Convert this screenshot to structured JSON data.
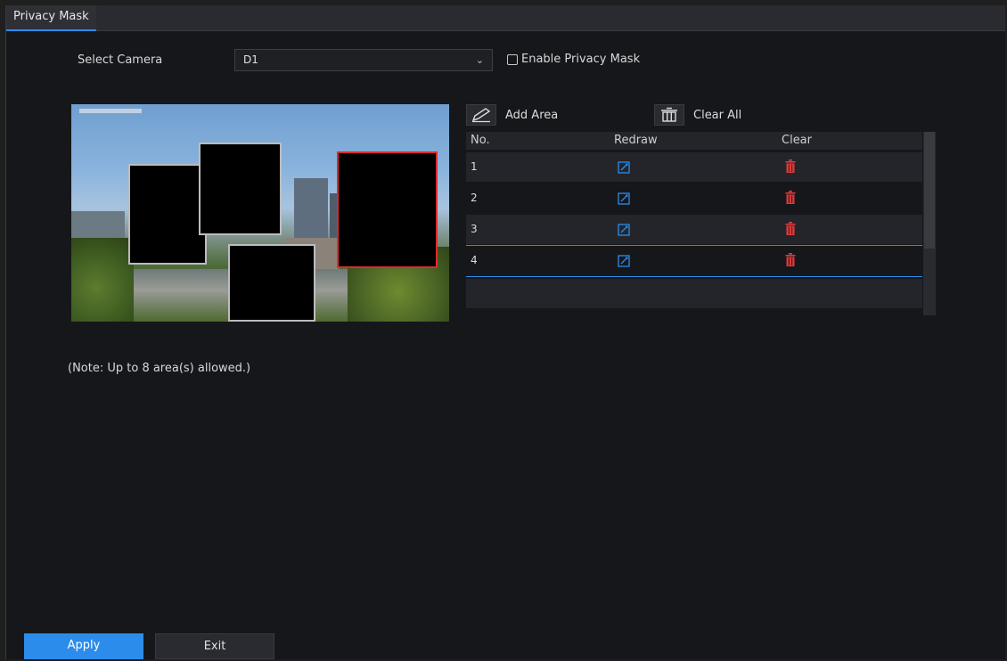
{
  "tab": {
    "label": "Privacy Mask"
  },
  "form": {
    "select_camera_label": "Select Camera",
    "camera_value": "D1",
    "enable_label": "Enable Privacy Mask",
    "enable_checked": false
  },
  "toolbar": {
    "add_area_label": "Add Area",
    "clear_all_label": "Clear All"
  },
  "table": {
    "columns": [
      "No.",
      "Redraw",
      "Clear"
    ],
    "rows": [
      {
        "no": "1"
      },
      {
        "no": "2"
      },
      {
        "no": "3"
      },
      {
        "no": "4"
      }
    ],
    "selected_row": "4"
  },
  "note": "(Note: Up to 8 area(s) allowed.)",
  "buttons": {
    "apply": "Apply",
    "exit": "Exit"
  },
  "colors": {
    "accent": "#2b8ceb",
    "delete": "#e03a3a",
    "active_mask_border": "#e12a2a"
  },
  "icons": {
    "add_area": "pencil-icon",
    "clear_all": "trash-icon",
    "redraw": "edit-icon",
    "clear": "delete-icon",
    "dropdown": "chevron-down-icon"
  }
}
